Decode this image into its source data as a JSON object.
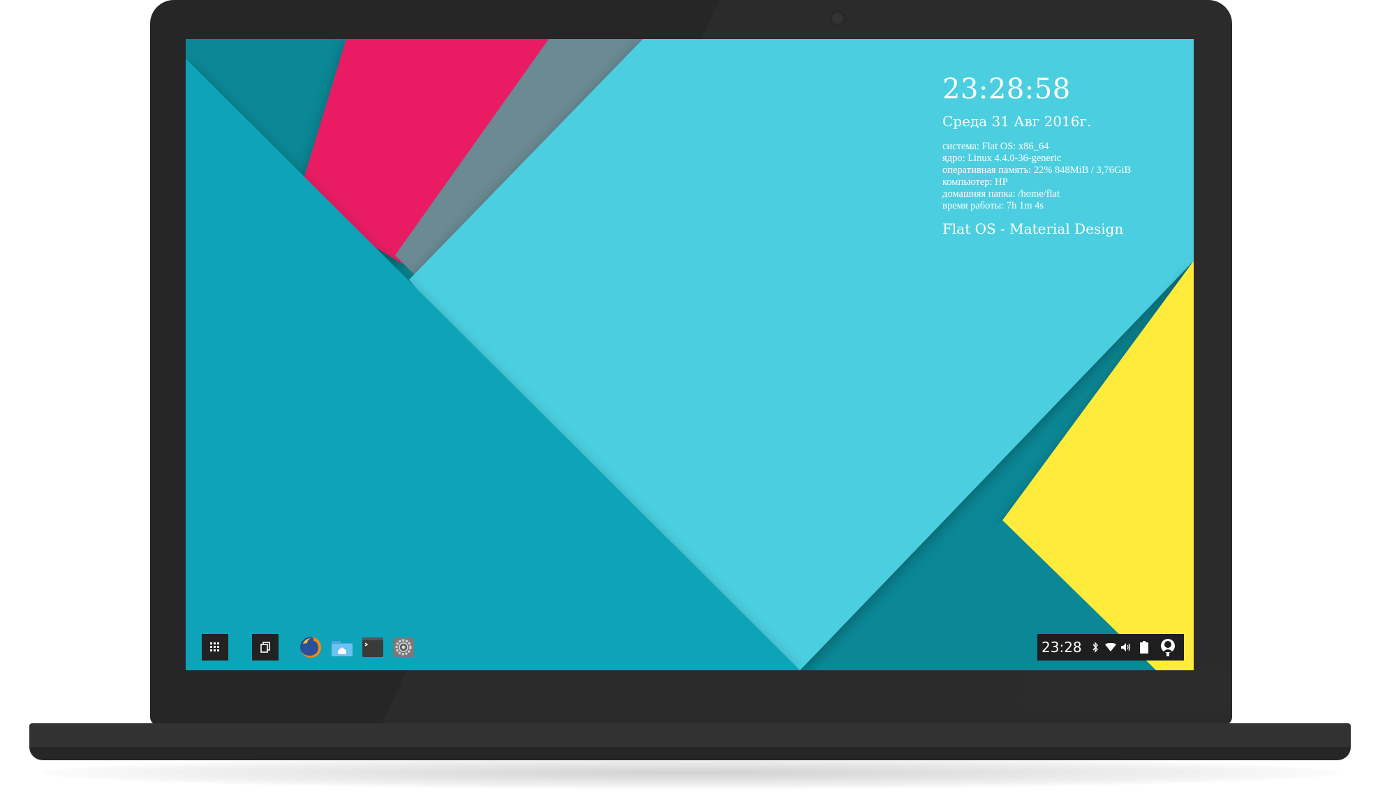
{
  "desktop": {
    "clock": "23:28:58",
    "date": "Среда 31 Авг 2016г.",
    "sysinfo": [
      "система: Flat OS: x86_64",
      "ядро: Linux 4.4.0-36-generic",
      "оперативная память: 22% 848MiB / 3,76GiB",
      "компьютер: HP",
      "домашняя папка: /home/flat",
      "время работы: 7h 1m 4s"
    ],
    "tagline": "Flat OS - Material Design"
  },
  "taskbar": {
    "apps": [
      "firefox-icon",
      "files-home-icon",
      "terminal-icon",
      "settings-icon"
    ],
    "tray": {
      "time": "23:28",
      "icons": [
        "bluetooth-icon",
        "wifi-icon",
        "volume-icon",
        "battery-icon",
        "user-icon"
      ]
    }
  },
  "colors": {
    "teal_light": "#4ccfe0",
    "teal": "#0fa3b8",
    "teal_dark": "#0b8795",
    "pink": "#e91e63",
    "yellow": "#ffeb3b",
    "bezel": "#262626"
  }
}
